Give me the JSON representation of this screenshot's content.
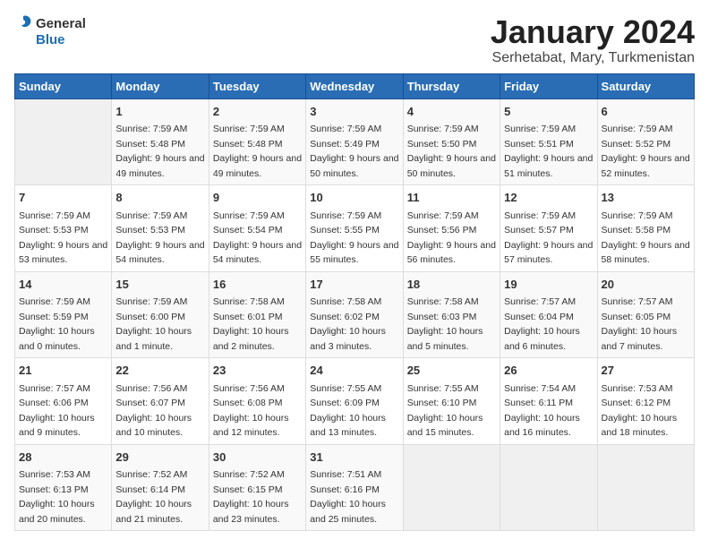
{
  "header": {
    "logo_line1": "General",
    "logo_line2": "Blue",
    "month": "January 2024",
    "location": "Serhetabat, Mary, Turkmenistan"
  },
  "days_of_week": [
    "Sunday",
    "Monday",
    "Tuesday",
    "Wednesday",
    "Thursday",
    "Friday",
    "Saturday"
  ],
  "weeks": [
    [
      {
        "num": "",
        "empty": true
      },
      {
        "num": "1",
        "sunrise": "Sunrise: 7:59 AM",
        "sunset": "Sunset: 5:48 PM",
        "daylight": "Daylight: 9 hours and 49 minutes."
      },
      {
        "num": "2",
        "sunrise": "Sunrise: 7:59 AM",
        "sunset": "Sunset: 5:48 PM",
        "daylight": "Daylight: 9 hours and 49 minutes."
      },
      {
        "num": "3",
        "sunrise": "Sunrise: 7:59 AM",
        "sunset": "Sunset: 5:49 PM",
        "daylight": "Daylight: 9 hours and 50 minutes."
      },
      {
        "num": "4",
        "sunrise": "Sunrise: 7:59 AM",
        "sunset": "Sunset: 5:50 PM",
        "daylight": "Daylight: 9 hours and 50 minutes."
      },
      {
        "num": "5",
        "sunrise": "Sunrise: 7:59 AM",
        "sunset": "Sunset: 5:51 PM",
        "daylight": "Daylight: 9 hours and 51 minutes."
      },
      {
        "num": "6",
        "sunrise": "Sunrise: 7:59 AM",
        "sunset": "Sunset: 5:52 PM",
        "daylight": "Daylight: 9 hours and 52 minutes."
      }
    ],
    [
      {
        "num": "7",
        "sunrise": "Sunrise: 7:59 AM",
        "sunset": "Sunset: 5:53 PM",
        "daylight": "Daylight: 9 hours and 53 minutes."
      },
      {
        "num": "8",
        "sunrise": "Sunrise: 7:59 AM",
        "sunset": "Sunset: 5:53 PM",
        "daylight": "Daylight: 9 hours and 54 minutes."
      },
      {
        "num": "9",
        "sunrise": "Sunrise: 7:59 AM",
        "sunset": "Sunset: 5:54 PM",
        "daylight": "Daylight: 9 hours and 54 minutes."
      },
      {
        "num": "10",
        "sunrise": "Sunrise: 7:59 AM",
        "sunset": "Sunset: 5:55 PM",
        "daylight": "Daylight: 9 hours and 55 minutes."
      },
      {
        "num": "11",
        "sunrise": "Sunrise: 7:59 AM",
        "sunset": "Sunset: 5:56 PM",
        "daylight": "Daylight: 9 hours and 56 minutes."
      },
      {
        "num": "12",
        "sunrise": "Sunrise: 7:59 AM",
        "sunset": "Sunset: 5:57 PM",
        "daylight": "Daylight: 9 hours and 57 minutes."
      },
      {
        "num": "13",
        "sunrise": "Sunrise: 7:59 AM",
        "sunset": "Sunset: 5:58 PM",
        "daylight": "Daylight: 9 hours and 58 minutes."
      }
    ],
    [
      {
        "num": "14",
        "sunrise": "Sunrise: 7:59 AM",
        "sunset": "Sunset: 5:59 PM",
        "daylight": "Daylight: 10 hours and 0 minutes."
      },
      {
        "num": "15",
        "sunrise": "Sunrise: 7:59 AM",
        "sunset": "Sunset: 6:00 PM",
        "daylight": "Daylight: 10 hours and 1 minute."
      },
      {
        "num": "16",
        "sunrise": "Sunrise: 7:58 AM",
        "sunset": "Sunset: 6:01 PM",
        "daylight": "Daylight: 10 hours and 2 minutes."
      },
      {
        "num": "17",
        "sunrise": "Sunrise: 7:58 AM",
        "sunset": "Sunset: 6:02 PM",
        "daylight": "Daylight: 10 hours and 3 minutes."
      },
      {
        "num": "18",
        "sunrise": "Sunrise: 7:58 AM",
        "sunset": "Sunset: 6:03 PM",
        "daylight": "Daylight: 10 hours and 5 minutes."
      },
      {
        "num": "19",
        "sunrise": "Sunrise: 7:57 AM",
        "sunset": "Sunset: 6:04 PM",
        "daylight": "Daylight: 10 hours and 6 minutes."
      },
      {
        "num": "20",
        "sunrise": "Sunrise: 7:57 AM",
        "sunset": "Sunset: 6:05 PM",
        "daylight": "Daylight: 10 hours and 7 minutes."
      }
    ],
    [
      {
        "num": "21",
        "sunrise": "Sunrise: 7:57 AM",
        "sunset": "Sunset: 6:06 PM",
        "daylight": "Daylight: 10 hours and 9 minutes."
      },
      {
        "num": "22",
        "sunrise": "Sunrise: 7:56 AM",
        "sunset": "Sunset: 6:07 PM",
        "daylight": "Daylight: 10 hours and 10 minutes."
      },
      {
        "num": "23",
        "sunrise": "Sunrise: 7:56 AM",
        "sunset": "Sunset: 6:08 PM",
        "daylight": "Daylight: 10 hours and 12 minutes."
      },
      {
        "num": "24",
        "sunrise": "Sunrise: 7:55 AM",
        "sunset": "Sunset: 6:09 PM",
        "daylight": "Daylight: 10 hours and 13 minutes."
      },
      {
        "num": "25",
        "sunrise": "Sunrise: 7:55 AM",
        "sunset": "Sunset: 6:10 PM",
        "daylight": "Daylight: 10 hours and 15 minutes."
      },
      {
        "num": "26",
        "sunrise": "Sunrise: 7:54 AM",
        "sunset": "Sunset: 6:11 PM",
        "daylight": "Daylight: 10 hours and 16 minutes."
      },
      {
        "num": "27",
        "sunrise": "Sunrise: 7:53 AM",
        "sunset": "Sunset: 6:12 PM",
        "daylight": "Daylight: 10 hours and 18 minutes."
      }
    ],
    [
      {
        "num": "28",
        "sunrise": "Sunrise: 7:53 AM",
        "sunset": "Sunset: 6:13 PM",
        "daylight": "Daylight: 10 hours and 20 minutes."
      },
      {
        "num": "29",
        "sunrise": "Sunrise: 7:52 AM",
        "sunset": "Sunset: 6:14 PM",
        "daylight": "Daylight: 10 hours and 21 minutes."
      },
      {
        "num": "30",
        "sunrise": "Sunrise: 7:52 AM",
        "sunset": "Sunset: 6:15 PM",
        "daylight": "Daylight: 10 hours and 23 minutes."
      },
      {
        "num": "31",
        "sunrise": "Sunrise: 7:51 AM",
        "sunset": "Sunset: 6:16 PM",
        "daylight": "Daylight: 10 hours and 25 minutes."
      },
      {
        "num": "",
        "empty": true
      },
      {
        "num": "",
        "empty": true
      },
      {
        "num": "",
        "empty": true
      }
    ]
  ]
}
